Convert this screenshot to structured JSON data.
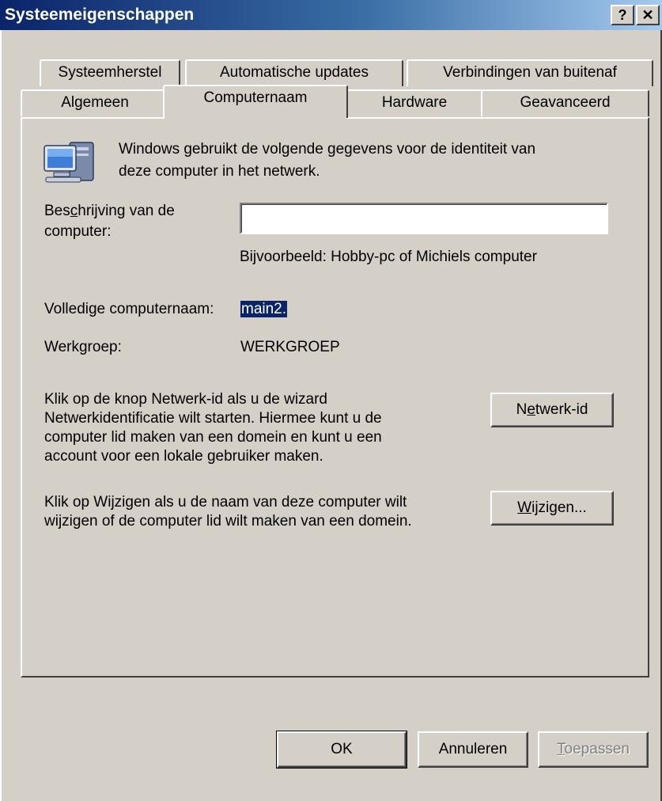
{
  "window": {
    "title": "Systeemeigenschappen",
    "help_label": "?",
    "close_label": "✕"
  },
  "tabs_row1": [
    "Systeemherstel",
    "Automatische updates",
    "Verbindingen van buitenaf"
  ],
  "tabs_row2": [
    "Algemeen",
    "Computernaam",
    "Hardware",
    "Geavanceerd"
  ],
  "active_tab": "Computernaam",
  "content": {
    "intro_line1": "Windows gebruikt de volgende gegevens voor de identiteit van",
    "intro_line2": "deze computer in het netwerk.",
    "description_label_line1_pre": "Bes",
    "description_label_line1_u": "c",
    "description_label_line1_post": "hrijving van de",
    "description_label_line2": "computer:",
    "description_value": "",
    "example_text": "Bijvoorbeeld: Hobby-pc of Michiels computer",
    "fullname_label": "Volledige computernaam:",
    "fullname_value": "main2.",
    "workgroup_label": "Werkgroep:",
    "workgroup_value": "WERKGROEP",
    "networkid_text": [
      "Klik op de knop Netwerk-id als u de wizard",
      "Netwerkidentificatie wilt starten. Hiermee kunt u de",
      "computer lid maken van een domein en kunt u een",
      "account voor een lokale gebruiker maken."
    ],
    "networkid_button_pre": "N",
    "networkid_button_u": "e",
    "networkid_button_post": "twerk-id",
    "change_text": [
      "Klik op Wijzigen als u de naam van deze computer wilt",
      "wijzigen of de computer lid wilt maken van een domein."
    ],
    "change_button_u": "W",
    "change_button_post": "ijzigen..."
  },
  "buttons": {
    "ok": "OK",
    "cancel": "Annuleren",
    "apply_u": "T",
    "apply_post": "oepassen"
  },
  "colors": {
    "face": "#d4d0c8",
    "title_gradient_start": "#0a246a",
    "title_gradient_end": "#a6caf0",
    "selection": "#0a246a"
  },
  "icons": [
    "computer-icon",
    "help-icon",
    "close-icon"
  ]
}
